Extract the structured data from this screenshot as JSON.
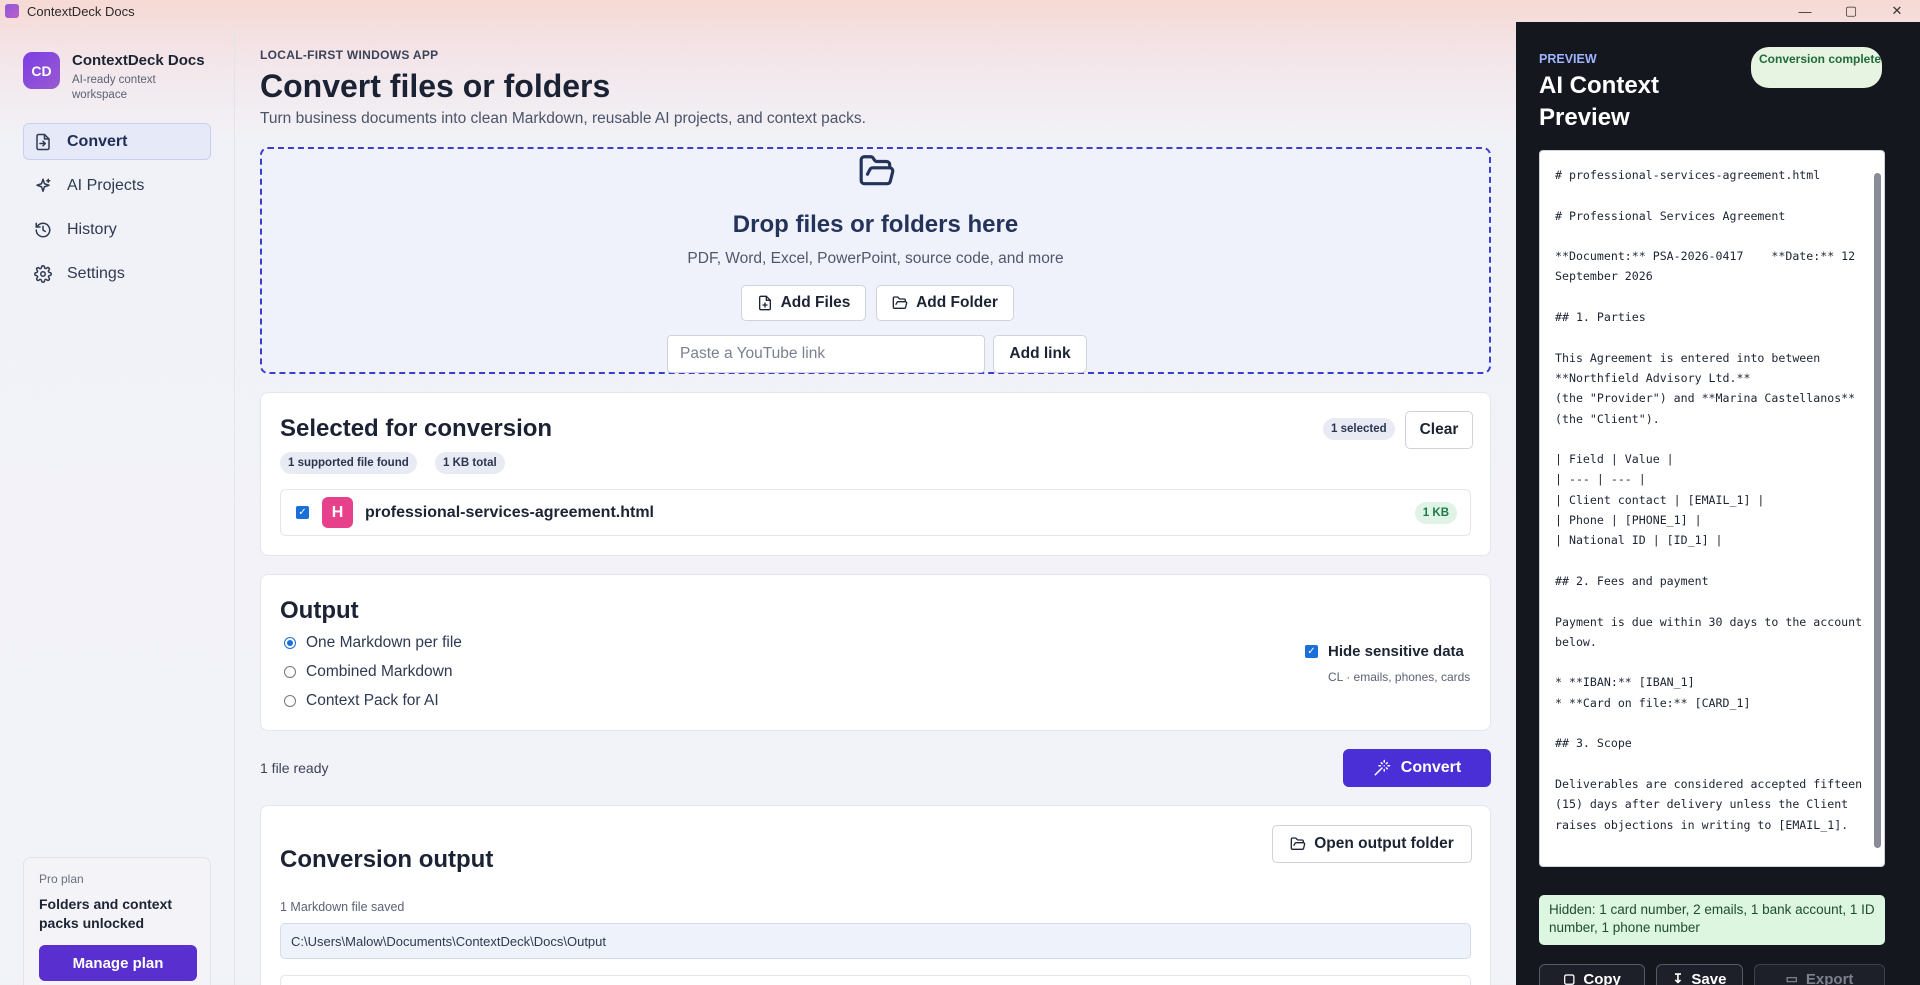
{
  "window": {
    "title": "ContextDeck Docs",
    "controls": [
      "—",
      "▢",
      "✕"
    ]
  },
  "sidebar": {
    "logo": "CD",
    "brand_name": "ContextDeck Docs",
    "brand_sub": "AI-ready context workspace",
    "items": [
      {
        "label": "Convert",
        "icon": "file-convert-icon",
        "active": true
      },
      {
        "label": "AI Projects",
        "icon": "sparkle-icon",
        "active": false
      },
      {
        "label": "History",
        "icon": "history-icon",
        "active": false
      },
      {
        "label": "Settings",
        "icon": "gear-icon",
        "active": false
      }
    ],
    "plan": {
      "label": "Pro plan",
      "text": "Folders and context packs unlocked",
      "button": "Manage plan"
    }
  },
  "header": {
    "eyebrow": "LOCAL-FIRST WINDOWS APP",
    "title": "Convert files or folders",
    "subtitle": "Turn business documents into clean Markdown, reusable AI projects, and context packs."
  },
  "dropzone": {
    "title": "Drop files or folders here",
    "subtitle": "PDF, Word, Excel, PowerPoint, source code, and more",
    "add_files": "Add Files",
    "add_folder": "Add Folder",
    "link_placeholder": "Paste a YouTube link",
    "add_link": "Add link"
  },
  "selection": {
    "title": "Selected for conversion",
    "found_pill": "1 supported file found",
    "total_pill": "1 KB total",
    "selected_pill": "1 selected",
    "clear": "Clear",
    "files": [
      {
        "badge": "H",
        "name": "professional-services-agreement.html",
        "size": "1 KB",
        "checked": true
      }
    ]
  },
  "output": {
    "title": "Output",
    "options": [
      {
        "label": "One Markdown per file",
        "selected": true
      },
      {
        "label": "Combined Markdown",
        "selected": false
      },
      {
        "label": "Context Pack for AI",
        "selected": false
      }
    ],
    "hide_sensitive_label": "Hide sensitive data",
    "hide_sensitive_checked": true,
    "hide_sensitive_sub": "CL · emails, phones, cards"
  },
  "action": {
    "ready": "1 file ready",
    "convert": "Convert"
  },
  "conversion_output": {
    "title": "Conversion output",
    "open_folder": "Open output folder",
    "saved": "1 Markdown file saved",
    "path": "C:\\Users\\Malow\\Documents\\ContextDeck\\Docs\\Output"
  },
  "preview": {
    "eyebrow": "PREVIEW",
    "title": "AI Context Preview",
    "status": "Conversion complete",
    "content": "# professional-services-agreement.html\n\n# Professional Services Agreement\n\n**Document:** PSA-2026-0417    **Date:** 12 September 2026\n\n## 1. Parties\n\nThis Agreement is entered into between **Northfield Advisory Ltd.**\n(the \"Provider\") and **Marina Castellanos** (the \"Client\").\n\n| Field | Value |\n| --- | --- |\n| Client contact | [EMAIL_1] |\n| Phone | [PHONE_1] |\n| National ID | [ID_1] |\n\n## 2. Fees and payment\n\nPayment is due within 30 days to the account below.\n\n* **IBAN:** [IBAN_1]\n* **Card on file:** [CARD_1]\n\n## 3. Scope\n\nDeliverables are considered accepted fifteen (15) days after delivery unless the Client raises objections in writing to [EMAIL_1].",
    "hidden_note": "Hidden: 1 card number, 2 emails, 1 bank account, 1 ID number, 1 phone number",
    "buttons": {
      "copy": "Copy",
      "save": "Save",
      "export": "Export"
    }
  },
  "colors": {
    "accent": "#4b2fd6",
    "sidebar_active": "#e6e9f8",
    "preview_bg": "#15171f",
    "success_bg": "#dcf6e0"
  }
}
